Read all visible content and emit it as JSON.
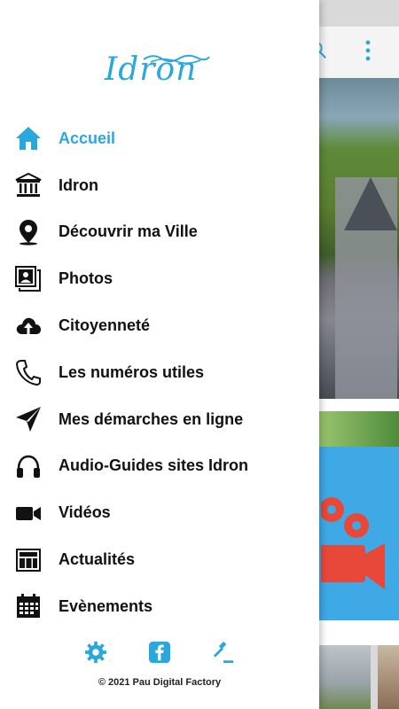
{
  "colors": {
    "accent": "#2aa7dc",
    "text": "#111111"
  },
  "logo": {
    "text": "Idron"
  },
  "menu": {
    "items": [
      {
        "label": "Accueil",
        "icon": "home-icon",
        "active": true
      },
      {
        "label": "Idron",
        "icon": "town-hall-icon"
      },
      {
        "label": "Découvrir ma Ville",
        "icon": "map-pin-icon"
      },
      {
        "label": "Photos",
        "icon": "photos-icon"
      },
      {
        "label": "Citoyenneté",
        "icon": "cloud-upload-icon"
      },
      {
        "label": "Les numéros utiles",
        "icon": "phone-icon"
      },
      {
        "label": "Mes démarches en ligne",
        "icon": "paper-plane-icon"
      },
      {
        "label": "Audio-Guides sites Idron",
        "icon": "headphones-icon"
      },
      {
        "label": "Vidéos",
        "icon": "video-camera-icon"
      },
      {
        "label": "Actualités",
        "icon": "newspaper-icon"
      },
      {
        "label": "Evènements",
        "icon": "calendar-icon"
      }
    ]
  },
  "footer": {
    "icons": [
      "settings-icon",
      "facebook-icon",
      "legal-gavel-icon"
    ],
    "copyright": "© 2021 Pau Digital Factory"
  }
}
